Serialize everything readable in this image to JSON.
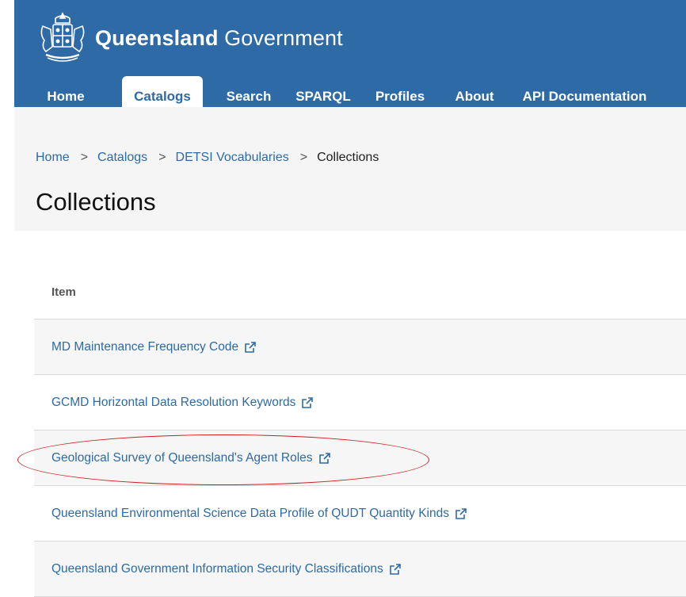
{
  "header": {
    "brand_bold": "Queensland",
    "brand_regular": " Government",
    "crest_icon": "queensland-crest-icon",
    "background": "#2e6aa6"
  },
  "nav": {
    "items": [
      {
        "label": "Home",
        "active": false
      },
      {
        "label": "Catalogs",
        "active": true
      },
      {
        "label": "Search",
        "active": false
      },
      {
        "label": "SPARQL",
        "active": false
      },
      {
        "label": "Profiles",
        "active": false
      },
      {
        "label": "About",
        "active": false
      },
      {
        "label": "API Documentation",
        "active": false
      }
    ]
  },
  "breadcrumb": {
    "items": [
      "Home",
      "Catalogs",
      "DETSI Vocabularies"
    ],
    "separator": ">",
    "current": "Collections"
  },
  "page_title": "Collections",
  "table": {
    "header": "Item",
    "rows": [
      {
        "label": "MD Maintenance Frequency Code",
        "icon": "external-link-icon"
      },
      {
        "label": "GCMD Horizontal Data Resolution Keywords",
        "icon": "external-link-icon"
      },
      {
        "label": "Geological Survey of Queensland's Agent Roles",
        "icon": "external-link-icon",
        "highlighted": true
      },
      {
        "label": "Queensland Environmental Science Data Profile of QUDT Quantity Kinds",
        "icon": "external-link-icon"
      },
      {
        "label": "Queensland Government Information Security Classifications",
        "icon": "external-link-icon"
      }
    ]
  },
  "colors": {
    "accent": "#2e6aa6",
    "annotation": "#cc1f1f"
  }
}
